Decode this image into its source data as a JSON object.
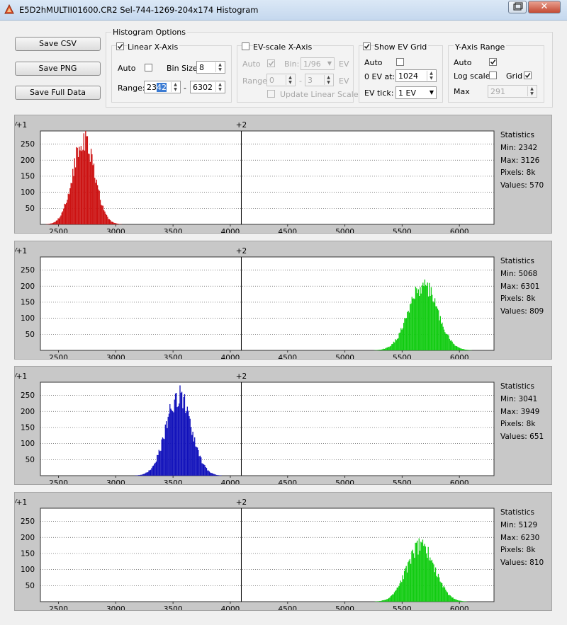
{
  "window": {
    "title": "E5D2hMULTII01600.CR2 Sel-744-1269-204x174 Histogram",
    "close_glyph": "✕"
  },
  "buttons": {
    "save_csv": "Save CSV",
    "save_png": "Save PNG",
    "save_full": "Save Full Data"
  },
  "histogram_options": {
    "title": "Histogram Options",
    "linear_x_axis": {
      "label": "Linear X-Axis",
      "checked": true
    },
    "auto": {
      "label": "Auto",
      "checked": false
    },
    "bin_size": {
      "label": "Bin Size:",
      "value": "8"
    },
    "range": {
      "label": "Range:",
      "min_prefix": "23",
      "min_selected": "42",
      "separator": "-",
      "max": "6302"
    }
  },
  "ev_scale": {
    "label": "EV-scale X-Axis",
    "checked": false,
    "auto": {
      "label": "Auto",
      "checked": true
    },
    "bin": {
      "label": "Bin:",
      "value": "1/96",
      "unit": "EV"
    },
    "range": {
      "label": "Range",
      "min": "0",
      "separator": "-",
      "max": "3",
      "unit": "EV"
    },
    "update_linear": {
      "label": "Update Linear Scale",
      "checked": false
    }
  },
  "ev_grid": {
    "label": "Show EV Grid",
    "checked": true,
    "auto": {
      "label": "Auto",
      "checked": false
    },
    "zero_ev": {
      "label": "0 EV at:",
      "value": "1024"
    },
    "tick": {
      "label": "EV tick:",
      "value": "1 EV"
    }
  },
  "y_axis": {
    "title": "Y-Axis Range",
    "auto": {
      "label": "Auto",
      "checked": true
    },
    "log": {
      "label": "Log scale",
      "checked": false
    },
    "grid": {
      "label": "Grid",
      "checked": true
    },
    "max": {
      "label": "Max",
      "value": "291"
    }
  },
  "x_axis": {
    "min": 2342,
    "max": 6302,
    "ticks": [
      "2500",
      "3000",
      "3500",
      "4000",
      "4500",
      "5000",
      "5500",
      "6000"
    ],
    "tick_values": [
      2500,
      3000,
      3500,
      4000,
      4500,
      5000,
      5500,
      6000
    ],
    "ev_markers": [
      {
        "label": "+1",
        "value": 2048
      },
      {
        "label": "+2",
        "value": 4096
      }
    ]
  },
  "y_axis_ticks": [
    "50",
    "100",
    "150",
    "200",
    "250"
  ],
  "y_tick_values": [
    50,
    100,
    150,
    200,
    250
  ],
  "y_max": 291,
  "chart_data": [
    {
      "type": "bar",
      "channel": "red",
      "color": "#cc1111",
      "peak": 275,
      "mean": 2715,
      "std": 95,
      "stats": {
        "title": "Statistics",
        "min": "Min: 2342",
        "max": "Max: 3126",
        "pixels": "Pixels: 8k",
        "values": "Values: 570"
      }
    },
    {
      "type": "bar",
      "channel": "green1",
      "color": "#11cc11",
      "peak": 210,
      "mean": 5680,
      "std": 125,
      "stats": {
        "title": "Statistics",
        "min": "Min: 5068",
        "max": "Max: 6301",
        "pixels": "Pixels: 8k",
        "values": "Values: 809"
      }
    },
    {
      "type": "bar",
      "channel": "blue",
      "color": "#1111bb",
      "peak": 258,
      "mean": 3545,
      "std": 110,
      "stats": {
        "title": "Statistics",
        "min": "Min: 3041",
        "max": "Max: 3949",
        "pixels": "Pixels: 8k",
        "values": "Values: 651"
      }
    },
    {
      "type": "bar",
      "channel": "green2",
      "color": "#11cc11",
      "peak": 182,
      "mean": 5660,
      "std": 120,
      "stats": {
        "title": "Statistics",
        "min": "Min: 5129",
        "max": "Max: 6230",
        "pixels": "Pixels: 8k",
        "values": "Values: 810"
      }
    }
  ]
}
